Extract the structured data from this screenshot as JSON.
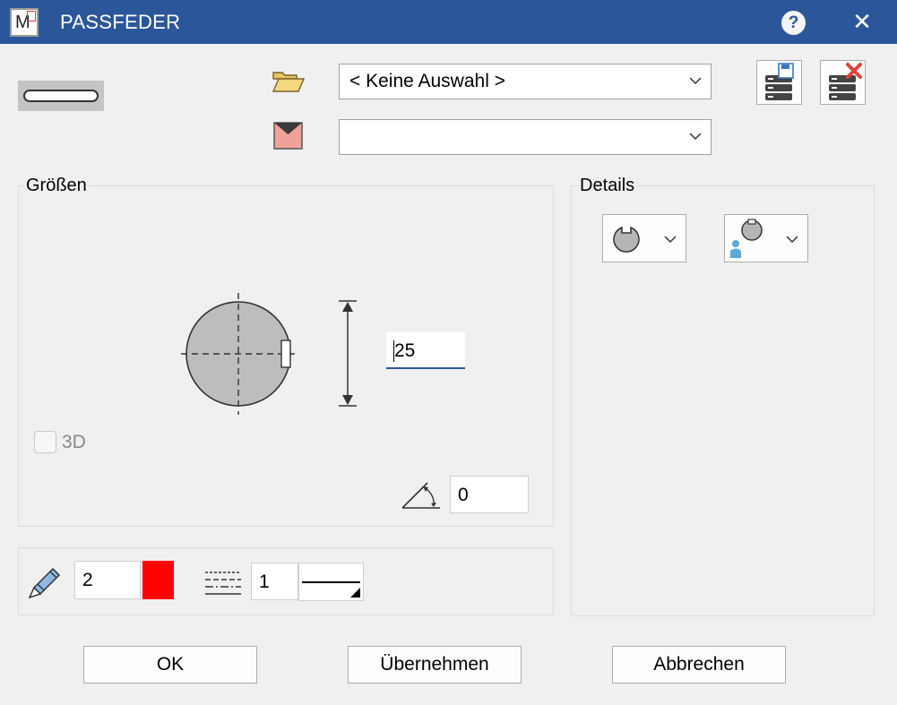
{
  "window": {
    "title": "PASSFEDER",
    "app_icon_letter": "M",
    "help_glyph": "?",
    "close_glyph": "✕"
  },
  "selection": {
    "folder_value": "< Keine Auswahl >",
    "second_value": ""
  },
  "groups": {
    "sizes_label": "Größen",
    "details_label": "Details"
  },
  "sizes": {
    "diameter": "25",
    "angle": "0",
    "checkbox_3d_label": "3D",
    "checkbox_3d_checked": false
  },
  "pen": {
    "width": "2",
    "color": "#ff0000",
    "linetype": "1"
  },
  "buttons": {
    "ok": "OK",
    "apply": "Übernehmen",
    "cancel": "Abbrechen"
  },
  "icons": {
    "shape_preview": "keyway-shape-icon",
    "folder": "folder-open-icon",
    "envelope": "envelope-icon",
    "save_db": "database-save-icon",
    "delete_db": "database-delete-icon",
    "detail1": "keyway-slot-icon",
    "detail2": "keyway-user-icon",
    "pen": "pencil-icon",
    "linetype": "linetype-icon",
    "angle": "angle-icon"
  }
}
